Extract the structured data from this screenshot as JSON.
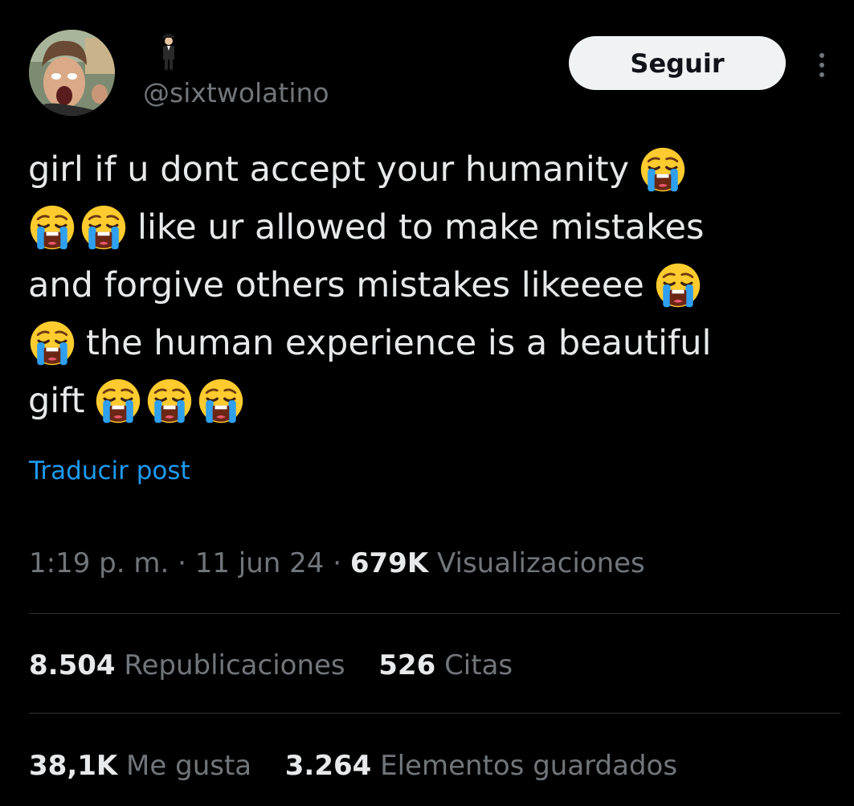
{
  "author": {
    "display_emoji": "🕴️",
    "handle": "@sixtwolatino",
    "avatar_icon": "avatar-photo"
  },
  "actions": {
    "follow_label": "Seguir",
    "more_icon": "more-options-icon"
  },
  "tweet": {
    "lines": [
      [
        "girl if u dont accept your humanity"
      ],
      [
        "like ur allowed to make mistakes"
      ],
      [
        "and forgive others mistakes likeeee"
      ],
      [
        "the human experience is a beautiful"
      ],
      [
        "gift"
      ]
    ],
    "emoji_icon": "loudly-crying-face",
    "translate_label": "Traducir post"
  },
  "meta": {
    "time": "1:19 p. m.",
    "separator": "·",
    "date": "11 jun 24",
    "views_count": "679K",
    "views_label": "Visualizaciones"
  },
  "stats": {
    "reposts_count": "8.504",
    "reposts_label": "Republicaciones",
    "quotes_count": "526",
    "quotes_label": "Citas",
    "likes_count": "38,1K",
    "likes_label": "Me gusta",
    "bookmarks_count": "3.264",
    "bookmarks_label": "Elementos guardados"
  },
  "colors": {
    "background": "#000000",
    "text": "#e7e9ea",
    "secondary": "#71767b",
    "link": "#1d9bf0",
    "divider": "#2f3336"
  }
}
